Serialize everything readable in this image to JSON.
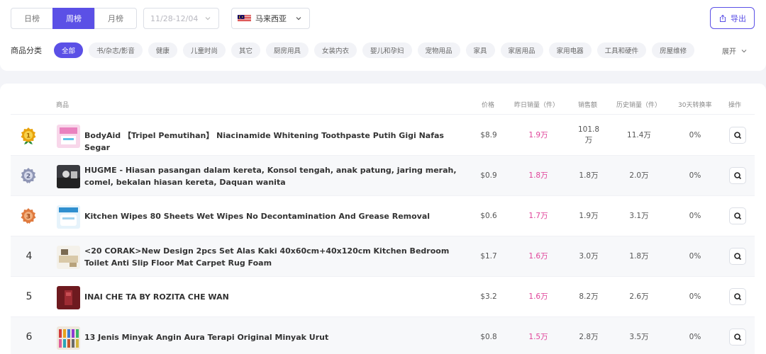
{
  "periods": [
    "日榜",
    "周榜",
    "月榜"
  ],
  "active_period": "周榜",
  "date_range": "11/28-12/04",
  "country": "马来西亚",
  "export_label": "导出",
  "categories": {
    "label": "商品分类",
    "items": [
      "全部",
      "书/杂志/影音",
      "健康",
      "儿童时尚",
      "其它",
      "厨房用具",
      "女装内衣",
      "婴儿和孕妇",
      "宠物用品",
      "家具",
      "家居用品",
      "家用电器",
      "工具和硬件",
      "房屋维修"
    ],
    "expand": "展开"
  },
  "table": {
    "headers": {
      "product": "商品",
      "price": "价格",
      "yesterday_sales": "昨日销量（件）",
      "revenue": "销售额",
      "history_sales": "历史销量（件）",
      "conversion": "30天转换率",
      "action": "操作"
    },
    "rows": [
      {
        "rank": "1",
        "title": "BodyAid 【Tripel Pemutihan】 Niacinamide Whitening Toothpaste Putih Gigi Nafas Segar",
        "price": "$8.9",
        "yesterday_sales": "1.9万",
        "revenue": "101.8 万",
        "history_sales": "11.4万",
        "conversion": "0%"
      },
      {
        "rank": "2",
        "title": "HUGME - Hiasan pasangan dalam kereta, Konsol tengah, anak patung, jaring merah, comel, bekalan hiasan kereta, Daquan wanita",
        "price": "$0.9",
        "yesterday_sales": "1.8万",
        "revenue": "1.8万",
        "history_sales": "2.0万",
        "conversion": "0%"
      },
      {
        "rank": "3",
        "title": "Kitchen Wipes 80 Sheets Wet Wipes No Decontamination And Grease Removal",
        "price": "$0.6",
        "yesterday_sales": "1.7万",
        "revenue": "1.9万",
        "history_sales": "3.1万",
        "conversion": "0%"
      },
      {
        "rank": "4",
        "title": "<20 CORAK>New Design 2pcs Set Alas Kaki 40x60cm+40x120cm Kitchen Bedroom Toilet Anti Slip Floor Mat Carpet Rug Foam",
        "price": "$1.7",
        "yesterday_sales": "1.6万",
        "revenue": "3.0万",
        "history_sales": "1.8万",
        "conversion": "0%"
      },
      {
        "rank": "5",
        "title": "INAI CHE TA BY ROZITA CHE WAN",
        "price": "$3.2",
        "yesterday_sales": "1.6万",
        "revenue": "8.2万",
        "history_sales": "2.6万",
        "conversion": "0%"
      },
      {
        "rank": "6",
        "title": "13 Jenis Minyak Angin Aura Terapi Original Minyak Urut",
        "price": "$0.8",
        "yesterday_sales": "1.5万",
        "revenue": "2.8万",
        "history_sales": "3.5万",
        "conversion": "0%"
      }
    ]
  },
  "colors": {
    "accent": "#5b50e6",
    "sales": "#e0449a",
    "gold": "#e8a20c",
    "silver": "#8f96b5",
    "bronze": "#e07a3e"
  },
  "icons": [
    "chevron-down-icon",
    "export-icon",
    "malaysia-flag-icon",
    "gold-medal-icon",
    "silver-medal-icon",
    "bronze-medal-icon",
    "search-icon"
  ]
}
